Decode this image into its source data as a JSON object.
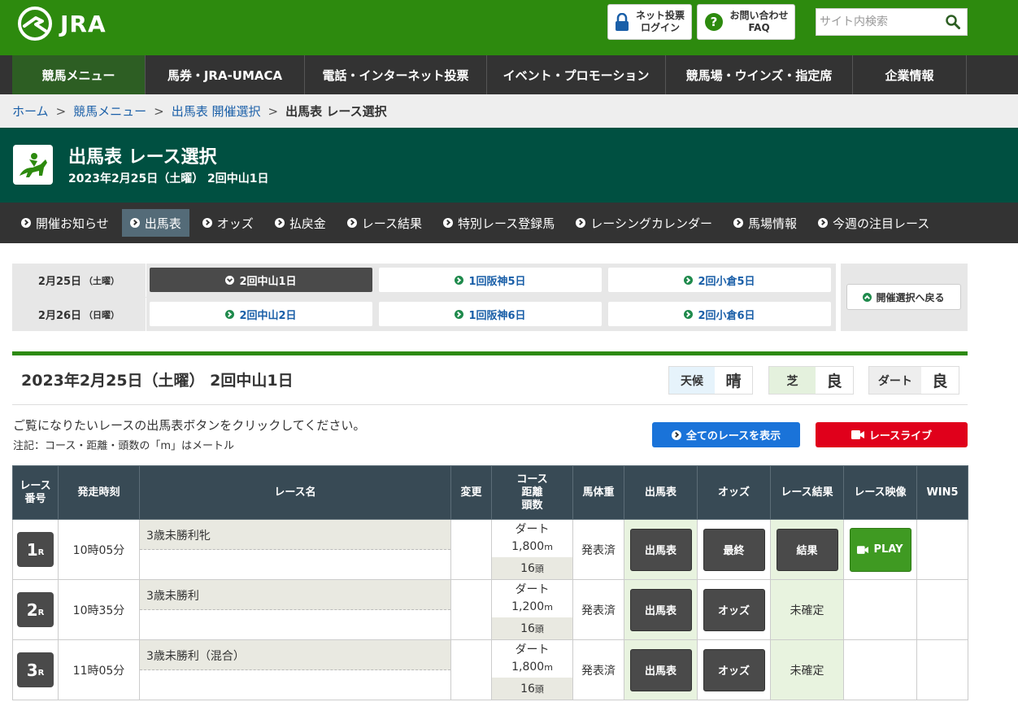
{
  "header": {
    "logo_text": "JRA",
    "login_line1": "ネット投票",
    "login_line2": "ログイン",
    "faq_line1": "お問い合わせ",
    "faq_line2": "FAQ",
    "search_placeholder": "サイト内検索"
  },
  "main_nav": [
    "競馬メニュー",
    "馬券・JRA-UMACA",
    "電話・インターネット投票",
    "イベント・プロモーション",
    "競馬場・ウインズ・指定席",
    "企業情報"
  ],
  "breadcrumb": {
    "home": "ホーム",
    "menu": "競馬メニュー",
    "select": "出馬表 開催選択",
    "current": "出馬表 レース選択",
    "sep": ">"
  },
  "title": {
    "main": "出馬表 レース選択",
    "sub": "2023年2月25日（土曜） 2回中山1日"
  },
  "sub_nav": [
    "開催お知らせ",
    "出馬表",
    "オッズ",
    "払戻金",
    "レース結果",
    "特別レース登録馬",
    "レーシングカレンダー",
    "馬場情報",
    "今週の注目レース"
  ],
  "meetings": {
    "row1": {
      "date": "2月25日",
      "dow": "（土曜）",
      "items": [
        "2回中山1日",
        "1回阪神5日",
        "2回小倉5日"
      ]
    },
    "row2": {
      "date": "2月26日",
      "dow": "（日曜）",
      "items": [
        "2回中山2日",
        "1回阪神6日",
        "2回小倉6日"
      ]
    },
    "back": "開催選択へ戻る"
  },
  "day": {
    "title": "2023年2月25日（土曜） 2回中山1日",
    "weather_label": "天候",
    "weather": "晴",
    "turf_label": "芝",
    "turf": "良",
    "dirt_label": "ダート",
    "dirt": "良"
  },
  "instruction": "ご覧になりたいレースの出馬表ボタンをクリックしてください。",
  "note": "注記：コース・距離・頭数の「m」はメートル",
  "buttons": {
    "show_all": "全てのレースを表示",
    "live": "レースライブ"
  },
  "table": {
    "headers": {
      "race_no_1": "レース",
      "race_no_2": "番号",
      "start": "発走時刻",
      "name": "レース名",
      "change": "変更",
      "course_1": "コース",
      "course_2": "距離",
      "course_3": "頭数",
      "weight": "馬体重",
      "card": "出馬表",
      "odds": "オッズ",
      "result": "レース結果",
      "video": "レース映像",
      "win5": "WIN5"
    },
    "rows": [
      {
        "num": "1",
        "suffix": "R",
        "time": "10時05分",
        "name": "3歳未勝利牝",
        "surface": "ダート",
        "distance": "1,800",
        "unit": "m",
        "runners": "16",
        "runners_unit": "頭",
        "weight": "発表済",
        "card": "出馬表",
        "odds": "最終",
        "result": "結果",
        "video": "PLAY"
      },
      {
        "num": "2",
        "suffix": "R",
        "time": "10時35分",
        "name": "3歳未勝利",
        "surface": "ダート",
        "distance": "1,200",
        "unit": "m",
        "runners": "16",
        "runners_unit": "頭",
        "weight": "発表済",
        "card": "出馬表",
        "odds": "オッズ",
        "result": "未確定"
      },
      {
        "num": "3",
        "suffix": "R",
        "time": "11時05分",
        "name": "3歳未勝利（混合）",
        "surface": "ダート",
        "distance": "1,800",
        "unit": "m",
        "runners": "16",
        "runners_unit": "頭",
        "weight": "発表済",
        "card": "出馬表",
        "odds": "オッズ",
        "result": "未確定"
      }
    ]
  },
  "colors": {
    "header_green": "#2d8a0e",
    "title_band": "#005041",
    "blue_button": "#1a73d9",
    "red_button": "#e0001b",
    "table_header": "#384a55"
  }
}
